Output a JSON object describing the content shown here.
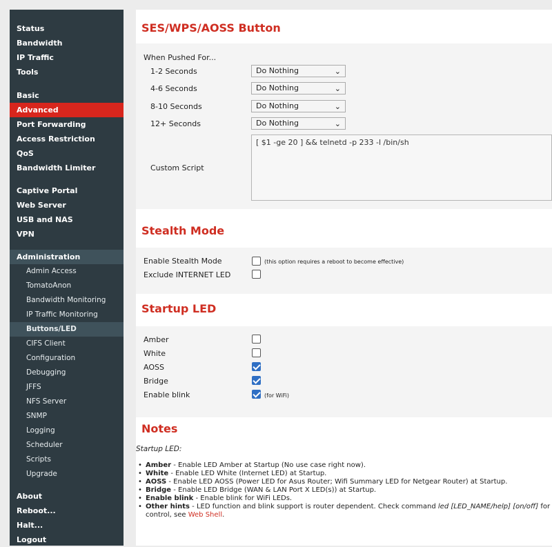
{
  "sidebar": {
    "status": "Status",
    "bandwidth": "Bandwidth",
    "ip_traffic": "IP Traffic",
    "tools": "Tools",
    "basic": "Basic",
    "advanced": "Advanced",
    "port_forwarding": "Port Forwarding",
    "access_restriction": "Access Restriction",
    "qos": "QoS",
    "bandwidth_limiter": "Bandwidth Limiter",
    "captive_portal": "Captive Portal",
    "web_server": "Web Server",
    "usb_nas": "USB and NAS",
    "vpn": "VPN",
    "administration": "Administration",
    "admin_items": [
      "Admin Access",
      "TomatoAnon",
      "Bandwidth Monitoring",
      "IP Traffic Monitoring",
      "Buttons/LED",
      "CIFS Client",
      "Configuration",
      "Debugging",
      "JFFS",
      "NFS Server",
      "SNMP",
      "Logging",
      "Scheduler",
      "Scripts",
      "Upgrade"
    ],
    "about": "About",
    "reboot": "Reboot...",
    "halt": "Halt...",
    "logout": "Logout"
  },
  "ses": {
    "title": "SES/WPS/AOSS Button",
    "when_pushed": "When Pushed For...",
    "rows": [
      {
        "label": "1-2 Seconds",
        "value": "Do Nothing"
      },
      {
        "label": "4-6 Seconds",
        "value": "Do Nothing"
      },
      {
        "label": "8-10 Seconds",
        "value": "Do Nothing"
      },
      {
        "label": "12+ Seconds",
        "value": "Do Nothing"
      }
    ],
    "custom_script_label": "Custom Script",
    "custom_script_value": "[ $1 -ge 20 ] && telnetd -p 233 -l /bin/sh"
  },
  "stealth": {
    "title": "Stealth Mode",
    "enable_label": "Enable Stealth Mode",
    "enable_checked": false,
    "enable_hint": "(this option requires a reboot to become effective)",
    "exclude_label": "Exclude INTERNET LED",
    "exclude_checked": false
  },
  "startup": {
    "title": "Startup LED",
    "amber_label": "Amber",
    "amber_checked": false,
    "white_label": "White",
    "white_checked": false,
    "aoss_label": "AOSS",
    "aoss_checked": true,
    "bridge_label": "Bridge",
    "bridge_checked": true,
    "blink_label": "Enable blink",
    "blink_checked": true,
    "blink_hint": "(for WiFi)"
  },
  "notes": {
    "title": "Notes",
    "subtitle": "Startup LED:",
    "amber_b": "Amber",
    "amber_t": " - Enable LED Amber at Startup (No use case right now).",
    "white_b": "White",
    "white_t": " - Enable LED White (Internet LED) at Startup.",
    "aoss_b": "AOSS",
    "aoss_t": " - Enable LED AOSS (Power LED for Asus Router; Wifi Summary LED for Netgear Router) at Startup.",
    "bridge_b": "Bridge",
    "bridge_t": " - Enable LED Bridge (WAN & LAN Port X LED(s)) at Startup.",
    "blink_b": "Enable blink",
    "blink_t": " - Enable blink for WiFi LEDs.",
    "other_b": "Other hints",
    "other_t1": " - LED function and blink support is router dependent. Check command ",
    "other_cmd": "led [LED_NAME/help] [on/off]",
    "other_t2": " for adv",
    "other_t3": "control, see ",
    "web_shell": "Web Shell",
    "other_t4": "."
  },
  "colors": {
    "accent": "#cf2e22",
    "sidebar_bg": "#2e3b42",
    "active_bg": "#d8261d",
    "checkbox_on": "#2f6fc4"
  }
}
